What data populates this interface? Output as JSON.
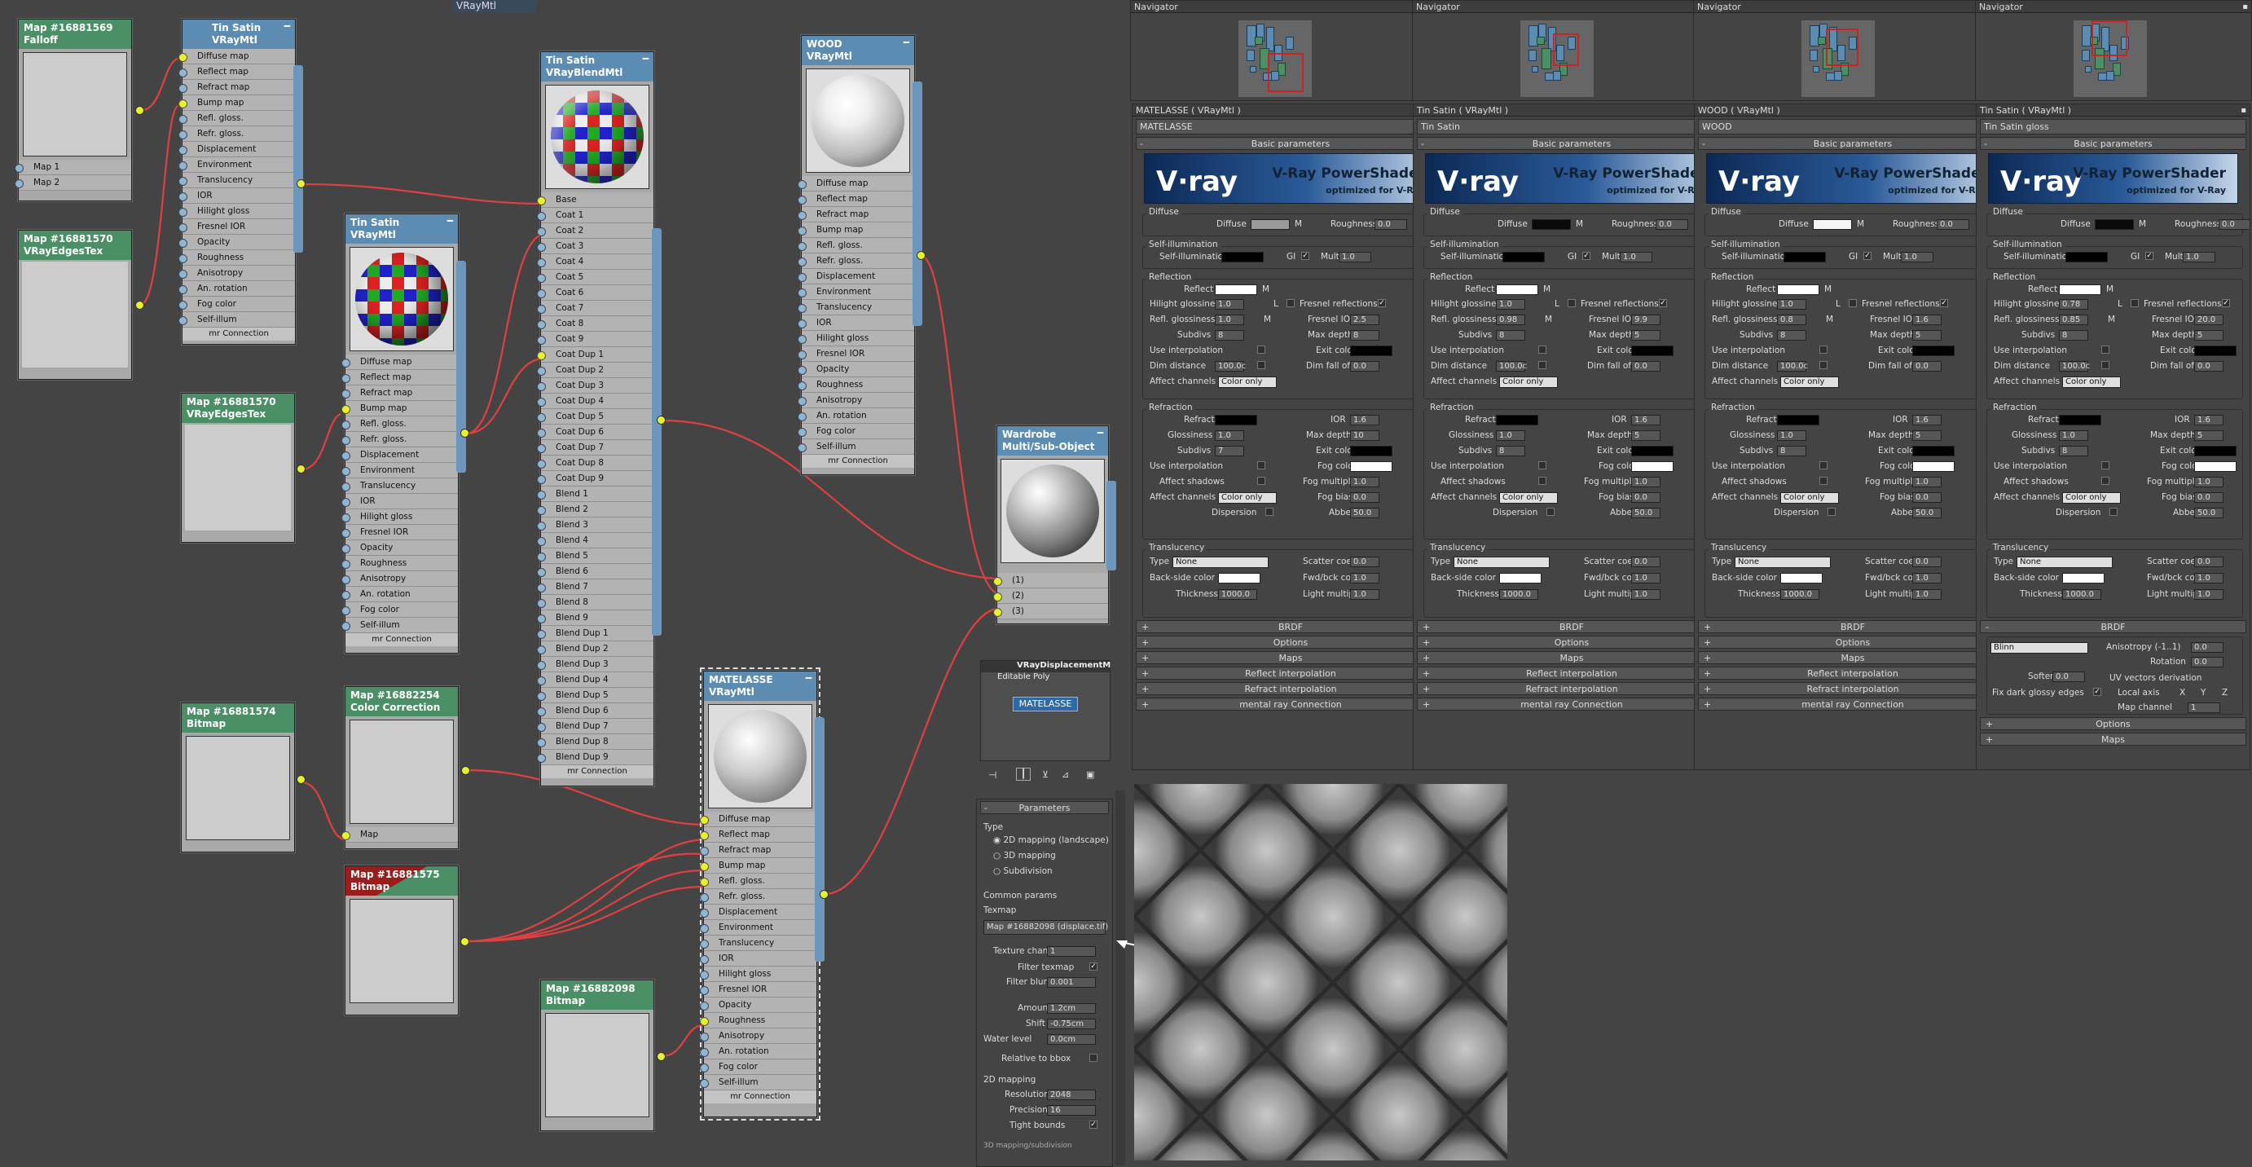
{
  "top_tab": "VRayMtl",
  "nodes": {
    "falloff": {
      "id": "Map #16881569",
      "type": "Falloff",
      "slots": [
        "Map 1",
        "Map 2"
      ]
    },
    "edges1": {
      "id": "Map #16881570",
      "type": "VRayEdgesTex"
    },
    "edges2": {
      "id": "Map #16881570",
      "type": "VRayEdgesTex"
    },
    "bitmap1": {
      "id": "Map #16881574",
      "type": "Bitmap"
    },
    "colorcorr": {
      "id": "Map #16882254",
      "type": "Color Correction",
      "slots": [
        "Map"
      ]
    },
    "bitmap2": {
      "id": "Map #16881575",
      "type": "Bitmap"
    },
    "bitmap3": {
      "id": "Map #16882098",
      "type": "Bitmap"
    },
    "tinsatin1": {
      "name": "Tin Satin",
      "type": "VRayMtl",
      "footer": "mr Connection",
      "slots": [
        "Diffuse map",
        "Reflect map",
        "Refract map",
        "Bump map",
        "Refl. gloss.",
        "Refr. gloss.",
        "Displacement",
        "Environment",
        "Translucency",
        "IOR",
        "Hilight gloss",
        "Fresnel IOR",
        "Opacity",
        "Roughness",
        "Anisotropy",
        "An. rotation",
        "Fog color",
        "Self-illum"
      ]
    },
    "tinsatin2": {
      "name": "Tin Satin",
      "type": "VRayMtl",
      "footer": "mr Connection",
      "slots": [
        "Diffuse map",
        "Reflect map",
        "Refract map",
        "Bump map",
        "Refl. gloss.",
        "Refr. gloss.",
        "Displacement",
        "Environment",
        "Translucency",
        "IOR",
        "Hilight gloss",
        "Fresnel IOR",
        "Opacity",
        "Roughness",
        "Anisotropy",
        "An. rotation",
        "Fog color",
        "Self-illum"
      ]
    },
    "blend": {
      "name": "Tin Satin",
      "type": "VRayBlendMtl",
      "footer": "mr Connection",
      "slots": [
        "Base",
        "Coat 1",
        "Coat 2",
        "Coat 3",
        "Coat 4",
        "Coat 5",
        "Coat 6",
        "Coat 7",
        "Coat 8",
        "Coat 9",
        "Coat Dup 1",
        "Coat Dup 2",
        "Coat Dup 3",
        "Coat Dup 4",
        "Coat Dup 5",
        "Coat Dup 6",
        "Coat Dup 7",
        "Coat Dup 8",
        "Coat Dup 9",
        "Blend 1",
        "Blend 2",
        "Blend 3",
        "Blend 4",
        "Blend 5",
        "Blend 6",
        "Blend 7",
        "Blend 8",
        "Blend 9",
        "Blend Dup 1",
        "Blend Dup 2",
        "Blend Dup 3",
        "Blend Dup 4",
        "Blend Dup 5",
        "Blend Dup 6",
        "Blend Dup 7",
        "Blend Dup 8",
        "Blend Dup 9"
      ]
    },
    "wood": {
      "name": "WOOD",
      "type": "VRayMtl",
      "footer": "mr Connection",
      "slots": [
        "Diffuse map",
        "Reflect map",
        "Refract map",
        "Bump map",
        "Refl. gloss.",
        "Refr. gloss.",
        "Displacement",
        "Environment",
        "Translucency",
        "IOR",
        "Hilight gloss",
        "Fresnel IOR",
        "Opacity",
        "Roughness",
        "Anisotropy",
        "An. rotation",
        "Fog color",
        "Self-illum"
      ]
    },
    "wardrobe": {
      "name": "Wardrobe",
      "type": "Multi/Sub-Object",
      "slots": [
        "(1)",
        "(2)",
        "(3)"
      ]
    },
    "matelasse": {
      "name": "MATELASSE",
      "type": "VRayMtl",
      "footer": "mr Connection",
      "slots": [
        "Diffuse map",
        "Reflect map",
        "Refract map",
        "Bump map",
        "Refl. gloss.",
        "Refr. gloss.",
        "Displacement",
        "Environment",
        "Translucency",
        "IOR",
        "Hilight gloss",
        "Fresnel IOR",
        "Opacity",
        "Roughness",
        "Anisotropy",
        "An. rotation",
        "Fog color",
        "Self-illum"
      ]
    },
    "disp": {
      "title": "VRayDisplacementM",
      "sub": "Editable Poly",
      "badge": "MATELASSE"
    }
  },
  "navigator": {
    "title": "Navigator"
  },
  "panels": [
    {
      "header": "MATELASSE  ( VRayMtl )",
      "name": "MATELASSE",
      "diffuse_color": "#999999",
      "hg": "1.0",
      "rg": "1.0",
      "subdivs": "8",
      "fior": "2.5",
      "maxd": "8",
      "refr_gloss": "1.0",
      "refr_subdivs": "7",
      "refr_maxd": "10"
    },
    {
      "header": "Tin Satin  ( VRayMtl )",
      "name": "Tin Satin",
      "diffuse_color": "#0a0a0a",
      "hg": "1.0",
      "rg": "0.98",
      "subdivs": "8",
      "fior": "9.9",
      "maxd": "5",
      "refr_gloss": "1.0",
      "refr_subdivs": "8",
      "refr_maxd": "5"
    },
    {
      "header": "WOOD  ( VRayMtl )",
      "name": "WOOD",
      "diffuse_color": "#f5f5f5",
      "hg": "1.0",
      "rg": "0.8",
      "subdivs": "8",
      "fior": "1.6",
      "maxd": "5",
      "refr_gloss": "1.0",
      "refr_subdivs": "8",
      "refr_maxd": "5"
    },
    {
      "header": "Tin Satin  ( VRayMtl )",
      "name": "Tin Satin gloss",
      "diffuse_color": "#0a0a0a",
      "hg": "0.78",
      "rg": "0.85",
      "subdivs": "8",
      "fior": "20.0",
      "maxd": "5",
      "refr_gloss": "1.0",
      "refr_subdivs": "8",
      "refr_maxd": "5"
    }
  ],
  "labels": {
    "basic": "Basic parameters",
    "vray": "V·ray",
    "ps1": "V-Ray PowerShader",
    "ps2": "optimized for V-Ray",
    "diffuse_grp": "Diffuse",
    "diffuse": "Diffuse",
    "roughness": "Roughness",
    "rough_val": "0.0",
    "selfillum_grp": "Self-illumination",
    "selfillum": "Self-illumination",
    "gi": "GI",
    "mult": "Mult",
    "mult_val": "1.0",
    "reflection_grp": "Reflection",
    "reflect": "Reflect",
    "hilight": "Hilight glossiness",
    "reflgloss": "Refl. glossiness",
    "fresnel": "Fresnel reflections",
    "fresnel_ior": "Fresnel IOR",
    "subdivs": "Subdivs",
    "maxdepth": "Max depth",
    "useinterp": "Use interpolation",
    "exitcolor": "Exit color",
    "dimdist": "Dim distance",
    "dimdist_val": "100.0c",
    "dimfall": "Dim fall off",
    "dimfall_val": "0.0",
    "affectch": "Affect channels",
    "coloronly": "Color only",
    "refraction_grp": "Refraction",
    "refract": "Refract",
    "ior": "IOR",
    "ior_val": "1.6",
    "glossiness": "Glossiness",
    "fogcolor": "Fog color",
    "affectshadows": "Affect shadows",
    "fogmult": "Fog multiplier",
    "fogmult_val": "1.0",
    "fogbias": "Fog bias",
    "fogbias_val": "0.0",
    "dispersion": "Dispersion",
    "abbe": "Abbe",
    "abbe_val": "50.0",
    "trans_grp": "Translucency",
    "type": "Type",
    "none": "None",
    "scatter": "Scatter coeff",
    "scatter_val": "0.0",
    "backside": "Back-side color",
    "fwdbck": "Fwd/bck coeff",
    "fwdbck_val": "1.0",
    "thickness": "Thickness",
    "thickness_val": "1000.0",
    "lightmult": "Light multiplier",
    "lightmult_val": "1.0",
    "brdf": "BRDF",
    "options": "Options",
    "maps": "Maps",
    "reflinterp": "Reflect interpolation",
    "refrinterp": "Refract interpolation",
    "mental": "mental ray Connection",
    "m": "M",
    "l": "L",
    "blinn": "Blinn",
    "aniso": "Anisotropy (-1..1)",
    "aniso_val": "0.0",
    "rotation": "Rotation",
    "rotation_val": "0.0",
    "soften": "Soften",
    "soften_val": "0.0",
    "uvder": "UV vectors derivation",
    "localaxis": "Local axis",
    "x": "X",
    "y": "Y",
    "z": "Z",
    "mapch": "Map channel",
    "mapch_val": "1",
    "fixdark": "Fix dark glossy edges"
  },
  "displacement": {
    "parameters": "Parameters",
    "type": "Type",
    "opt1": "2D mapping (landscape)",
    "opt2": "3D mapping",
    "opt3": "Subdivision",
    "common": "Common params",
    "texmap": "Texmap",
    "texmap_val": "Map #16882098 (displace.tif)",
    "texchan": "Texture chan",
    "texchan_val": "1",
    "filtertex": "Filter texmap",
    "filterblur": "Filter blur",
    "filterblur_val": "0.001",
    "amount": "Amount",
    "amount_val": "1.2cm",
    "shift": "Shift",
    "shift_val": "-0.75cm",
    "water": "Water level",
    "water_val": "0.0cm",
    "relbbox": "Relative to bbox",
    "map2d": "2D mapping",
    "resolution": "Resolution",
    "resolution_val": "2048",
    "precision": "Precision",
    "precision_val": "16",
    "tight": "Tight bounds",
    "footer": "3D mapping/subdivision"
  }
}
